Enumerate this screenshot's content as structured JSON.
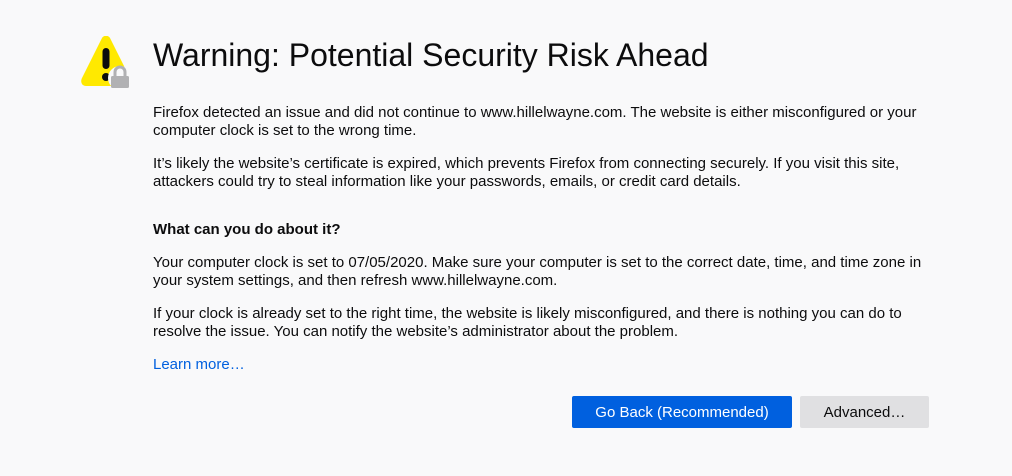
{
  "page": {
    "title": "Warning: Potential Security Risk Ahead",
    "intro": "Firefox detected an issue and did not continue to www.hillelwayne.com. The website is either misconfigured or your computer clock is set to the wrong time.",
    "explanation": "It’s likely the website’s certificate is expired, which prevents Firefox from connecting securely. If you visit this site, attackers could try to steal information like your passwords, emails, or credit card details.",
    "what_heading": "What can you do about it?",
    "clock_advice": "Your computer clock is set to 07/05/2020. Make sure your computer is set to the correct date, time, and time zone in your system settings, and then refresh www.hillelwayne.com.",
    "misconfig_advice": "If your clock is already set to the right time, the website is likely misconfigured, and there is nothing you can do to resolve the issue. You can notify the website’s administrator about the problem.",
    "learn_more": "Learn more…"
  },
  "buttons": {
    "go_back": "Go Back (Recommended)",
    "advanced": "Advanced…"
  },
  "icons": {
    "warning": "warning-lock-icon"
  },
  "colors": {
    "background": "#f9f9fa",
    "primary": "#0060df",
    "secondary": "#e0e0e2",
    "warning_yellow": "#ffe900",
    "lock_gray": "#b1b1b3"
  }
}
